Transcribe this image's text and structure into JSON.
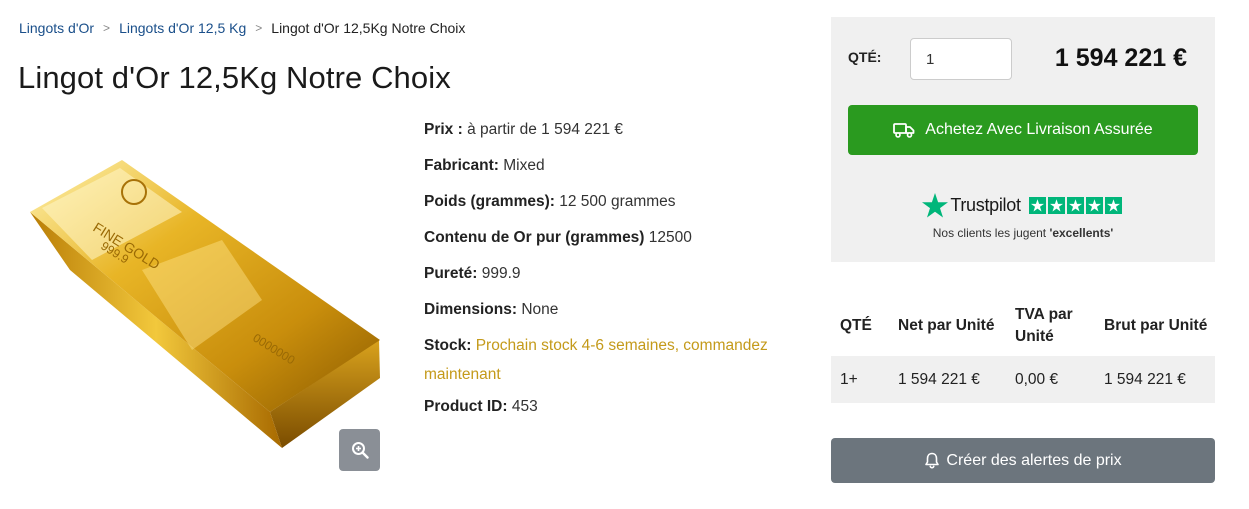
{
  "breadcrumb": {
    "items": [
      "Lingots d'Or",
      "Lingots d'Or 12,5 Kg"
    ],
    "separator": ">",
    "current": "Lingot d'Or 12,5Kg Notre Choix"
  },
  "product": {
    "title": "Lingot d'Or 12,5Kg Notre Choix",
    "image_icon": "gold-bar-image",
    "zoom_icon": "zoom-in-icon"
  },
  "specs": {
    "price_label": "Prix :",
    "price_value": "à partir de 1 594 221 €",
    "manufacturer_label": "Fabricant:",
    "manufacturer_value": "Mixed",
    "weight_label": "Poids (grammes):",
    "weight_value": "12 500 grammes",
    "content_label": "Contenu de Or pur (grammes)",
    "content_value": "12500",
    "purity_label": "Pureté:",
    "purity_value": "999.9",
    "dimensions_label": "Dimensions:",
    "dimensions_value": "None",
    "stock_label": "Stock:",
    "stock_value": "Prochain stock 4-6 semaines, commandez maintenant",
    "product_id_label": "Product ID:",
    "product_id_value": "453"
  },
  "buybox": {
    "qty_label": "QTÉ:",
    "qty_value": "1",
    "price": "1 594 221 €",
    "buy_button_label": "Achetez Avec Livraison Assurée",
    "buy_icon": "truck-icon"
  },
  "trustpilot": {
    "name": "Trustpilot",
    "stars": 5,
    "caption_prefix": "Nos clients les jugent",
    "caption_bold": "'excellents'",
    "color": "#00b67a"
  },
  "price_table": {
    "headers": [
      "QTÉ",
      "Net par Unité",
      "TVA par Unité",
      "Brut par Unité"
    ],
    "rows": [
      [
        "1+",
        "1 594 221 €",
        "0,00 €",
        "1 594 221 €"
      ]
    ]
  },
  "alerts": {
    "button_label": "Créer des alertes de prix",
    "icon": "bell-icon"
  },
  "colors": {
    "link": "#1a4f8a",
    "buy_green": "#2a9a1f",
    "stock_gold": "#c49a1a",
    "alert_gray": "#6c757d",
    "panel_bg": "#f0f0f0"
  }
}
